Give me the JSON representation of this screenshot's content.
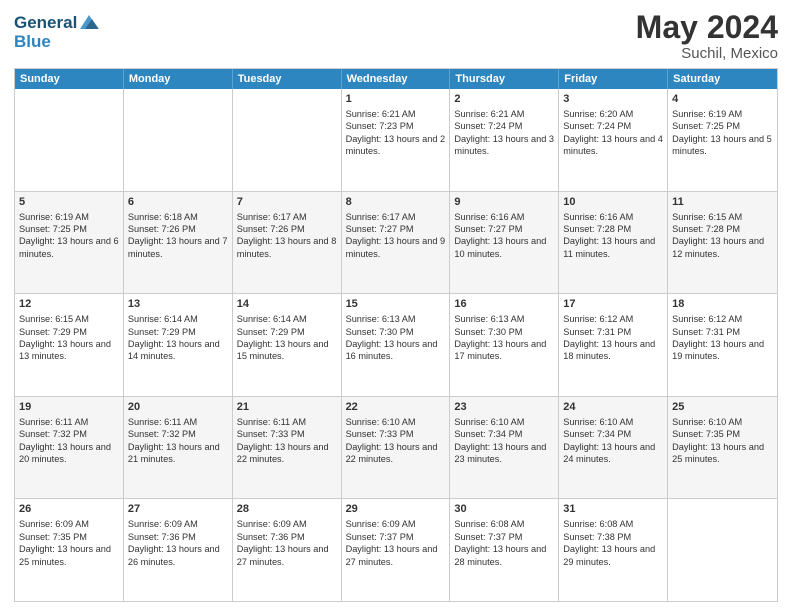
{
  "header": {
    "logo_line1": "General",
    "logo_line2": "Blue",
    "month": "May 2024",
    "location": "Suchil, Mexico"
  },
  "days_of_week": [
    "Sunday",
    "Monday",
    "Tuesday",
    "Wednesday",
    "Thursday",
    "Friday",
    "Saturday"
  ],
  "weeks": [
    [
      {
        "day": "",
        "sunrise": "",
        "sunset": "",
        "daylight": ""
      },
      {
        "day": "",
        "sunrise": "",
        "sunset": "",
        "daylight": ""
      },
      {
        "day": "",
        "sunrise": "",
        "sunset": "",
        "daylight": ""
      },
      {
        "day": "1",
        "sunrise": "Sunrise: 6:21 AM",
        "sunset": "Sunset: 7:23 PM",
        "daylight": "Daylight: 13 hours and 2 minutes."
      },
      {
        "day": "2",
        "sunrise": "Sunrise: 6:21 AM",
        "sunset": "Sunset: 7:24 PM",
        "daylight": "Daylight: 13 hours and 3 minutes."
      },
      {
        "day": "3",
        "sunrise": "Sunrise: 6:20 AM",
        "sunset": "Sunset: 7:24 PM",
        "daylight": "Daylight: 13 hours and 4 minutes."
      },
      {
        "day": "4",
        "sunrise": "Sunrise: 6:19 AM",
        "sunset": "Sunset: 7:25 PM",
        "daylight": "Daylight: 13 hours and 5 minutes."
      }
    ],
    [
      {
        "day": "5",
        "sunrise": "Sunrise: 6:19 AM",
        "sunset": "Sunset: 7:25 PM",
        "daylight": "Daylight: 13 hours and 6 minutes."
      },
      {
        "day": "6",
        "sunrise": "Sunrise: 6:18 AM",
        "sunset": "Sunset: 7:26 PM",
        "daylight": "Daylight: 13 hours and 7 minutes."
      },
      {
        "day": "7",
        "sunrise": "Sunrise: 6:17 AM",
        "sunset": "Sunset: 7:26 PM",
        "daylight": "Daylight: 13 hours and 8 minutes."
      },
      {
        "day": "8",
        "sunrise": "Sunrise: 6:17 AM",
        "sunset": "Sunset: 7:27 PM",
        "daylight": "Daylight: 13 hours and 9 minutes."
      },
      {
        "day": "9",
        "sunrise": "Sunrise: 6:16 AM",
        "sunset": "Sunset: 7:27 PM",
        "daylight": "Daylight: 13 hours and 10 minutes."
      },
      {
        "day": "10",
        "sunrise": "Sunrise: 6:16 AM",
        "sunset": "Sunset: 7:28 PM",
        "daylight": "Daylight: 13 hours and 11 minutes."
      },
      {
        "day": "11",
        "sunrise": "Sunrise: 6:15 AM",
        "sunset": "Sunset: 7:28 PM",
        "daylight": "Daylight: 13 hours and 12 minutes."
      }
    ],
    [
      {
        "day": "12",
        "sunrise": "Sunrise: 6:15 AM",
        "sunset": "Sunset: 7:29 PM",
        "daylight": "Daylight: 13 hours and 13 minutes."
      },
      {
        "day": "13",
        "sunrise": "Sunrise: 6:14 AM",
        "sunset": "Sunset: 7:29 PM",
        "daylight": "Daylight: 13 hours and 14 minutes."
      },
      {
        "day": "14",
        "sunrise": "Sunrise: 6:14 AM",
        "sunset": "Sunset: 7:29 PM",
        "daylight": "Daylight: 13 hours and 15 minutes."
      },
      {
        "day": "15",
        "sunrise": "Sunrise: 6:13 AM",
        "sunset": "Sunset: 7:30 PM",
        "daylight": "Daylight: 13 hours and 16 minutes."
      },
      {
        "day": "16",
        "sunrise": "Sunrise: 6:13 AM",
        "sunset": "Sunset: 7:30 PM",
        "daylight": "Daylight: 13 hours and 17 minutes."
      },
      {
        "day": "17",
        "sunrise": "Sunrise: 6:12 AM",
        "sunset": "Sunset: 7:31 PM",
        "daylight": "Daylight: 13 hours and 18 minutes."
      },
      {
        "day": "18",
        "sunrise": "Sunrise: 6:12 AM",
        "sunset": "Sunset: 7:31 PM",
        "daylight": "Daylight: 13 hours and 19 minutes."
      }
    ],
    [
      {
        "day": "19",
        "sunrise": "Sunrise: 6:11 AM",
        "sunset": "Sunset: 7:32 PM",
        "daylight": "Daylight: 13 hours and 20 minutes."
      },
      {
        "day": "20",
        "sunrise": "Sunrise: 6:11 AM",
        "sunset": "Sunset: 7:32 PM",
        "daylight": "Daylight: 13 hours and 21 minutes."
      },
      {
        "day": "21",
        "sunrise": "Sunrise: 6:11 AM",
        "sunset": "Sunset: 7:33 PM",
        "daylight": "Daylight: 13 hours and 22 minutes."
      },
      {
        "day": "22",
        "sunrise": "Sunrise: 6:10 AM",
        "sunset": "Sunset: 7:33 PM",
        "daylight": "Daylight: 13 hours and 22 minutes."
      },
      {
        "day": "23",
        "sunrise": "Sunrise: 6:10 AM",
        "sunset": "Sunset: 7:34 PM",
        "daylight": "Daylight: 13 hours and 23 minutes."
      },
      {
        "day": "24",
        "sunrise": "Sunrise: 6:10 AM",
        "sunset": "Sunset: 7:34 PM",
        "daylight": "Daylight: 13 hours and 24 minutes."
      },
      {
        "day": "25",
        "sunrise": "Sunrise: 6:10 AM",
        "sunset": "Sunset: 7:35 PM",
        "daylight": "Daylight: 13 hours and 25 minutes."
      }
    ],
    [
      {
        "day": "26",
        "sunrise": "Sunrise: 6:09 AM",
        "sunset": "Sunset: 7:35 PM",
        "daylight": "Daylight: 13 hours and 25 minutes."
      },
      {
        "day": "27",
        "sunrise": "Sunrise: 6:09 AM",
        "sunset": "Sunset: 7:36 PM",
        "daylight": "Daylight: 13 hours and 26 minutes."
      },
      {
        "day": "28",
        "sunrise": "Sunrise: 6:09 AM",
        "sunset": "Sunset: 7:36 PM",
        "daylight": "Daylight: 13 hours and 27 minutes."
      },
      {
        "day": "29",
        "sunrise": "Sunrise: 6:09 AM",
        "sunset": "Sunset: 7:37 PM",
        "daylight": "Daylight: 13 hours and 27 minutes."
      },
      {
        "day": "30",
        "sunrise": "Sunrise: 6:08 AM",
        "sunset": "Sunset: 7:37 PM",
        "daylight": "Daylight: 13 hours and 28 minutes."
      },
      {
        "day": "31",
        "sunrise": "Sunrise: 6:08 AM",
        "sunset": "Sunset: 7:38 PM",
        "daylight": "Daylight: 13 hours and 29 minutes."
      },
      {
        "day": "",
        "sunrise": "",
        "sunset": "",
        "daylight": ""
      }
    ]
  ]
}
